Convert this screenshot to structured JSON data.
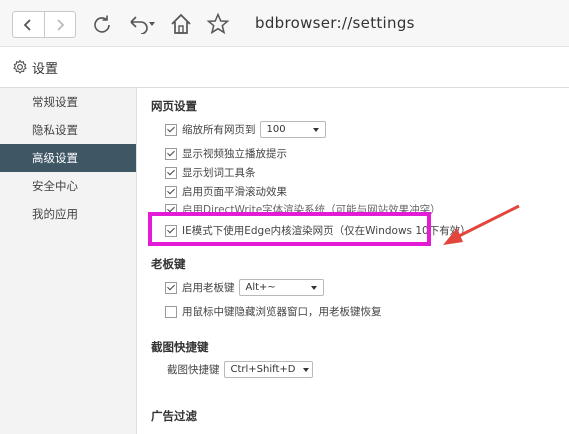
{
  "toolbar": {
    "back_icon": "chevron-left-icon",
    "forward_icon": "chevron-right-icon",
    "reload_icon": "reload-icon",
    "undo_icon": "undo-icon",
    "home_icon": "home-icon",
    "star_icon": "star-icon",
    "address": "bdbrowser://settings"
  },
  "page": {
    "title": "设置",
    "icon": "gear-icon"
  },
  "sidebar": {
    "items": [
      {
        "label": "常规设置",
        "active": false
      },
      {
        "label": "隐私设置",
        "active": false
      },
      {
        "label": "高级设置",
        "active": true
      },
      {
        "label": "安全中心",
        "active": false
      },
      {
        "label": "我的应用",
        "active": false
      }
    ],
    "active_color": "#3f5665"
  },
  "web": {
    "title": "网页设置",
    "zoom_label": "缩放所有网页到",
    "zoom_value": "100",
    "video_label": "显示视频独立播放提示",
    "translate_label": "显示划词工具条",
    "smooth_label": "启用页面平滑滚动效果",
    "directwrite_label": "启用DirectWrite字体渲染系统（可能与网站效果冲突）",
    "ie_edge_label": "IE模式下使用Edge内核渲染网页（仅在Windows 10下有效）"
  },
  "boss": {
    "title": "老板键",
    "enable_label": "启用老板键",
    "key_value": "Alt+~",
    "middle_label": "用鼠标中键隐藏浏览器窗口，用老板键恢复"
  },
  "screenshot": {
    "title": "截图快捷键",
    "label": "截图快捷键",
    "value": "Ctrl+Shift+D"
  },
  "adblock": {
    "title": "广告过滤"
  },
  "annotation": {
    "highlight_color": "#e31ad6",
    "arrow_color": "#e2453c"
  }
}
